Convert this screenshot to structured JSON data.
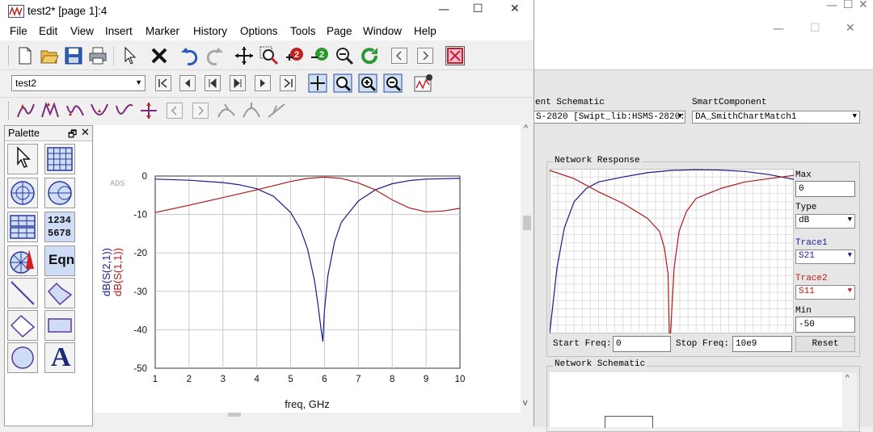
{
  "window": {
    "title": "test2* [page 1]:4"
  },
  "menu": [
    "File",
    "Edit",
    "View",
    "Insert",
    "Marker",
    "History",
    "Options",
    "Tools",
    "Page",
    "Window",
    "Help"
  ],
  "toolbar": {
    "page_select": "test2"
  },
  "palette": {
    "title": "Palette",
    "number_icon_top": "1234",
    "number_icon_bottom": "5678",
    "eqn_label": "Eqn",
    "text_label": "A"
  },
  "plot": {
    "watermark": "ADS",
    "xlabel": "freq, GHz",
    "ylabel_blue": "dB(S(2,1))",
    "ylabel_red": "dB(S(1,1))"
  },
  "chart_data": [
    {
      "type": "line",
      "title": "",
      "xlabel": "freq, GHz",
      "ylabel": "dB(S(2,1)) / dB(S(1,1))",
      "xlim": [
        1,
        10
      ],
      "ylim": [
        -50,
        0
      ],
      "xticks": [
        1,
        2,
        3,
        4,
        5,
        6,
        7,
        8,
        9,
        10
      ],
      "yticks": [
        0,
        -10,
        -20,
        -30,
        -40,
        -50
      ],
      "grid": true,
      "series": [
        {
          "name": "dB(S(2,1))",
          "color": "#1a1a8c",
          "x": [
            1,
            2,
            3,
            3.5,
            4,
            4.5,
            5,
            5.3,
            5.5,
            5.7,
            5.8,
            5.9,
            5.95,
            6.0,
            6.1,
            6.3,
            6.5,
            7,
            7.5,
            8,
            8.5,
            9,
            10
          ],
          "y": [
            -0.8,
            -1.1,
            -1.7,
            -2.3,
            -3.3,
            -5.3,
            -9.5,
            -14,
            -19,
            -27,
            -33,
            -40,
            -43,
            -35,
            -26,
            -17,
            -12,
            -6.5,
            -3.6,
            -2.0,
            -1.2,
            -0.8,
            -0.6
          ]
        },
        {
          "name": "dB(S(1,1))",
          "color": "#b01818",
          "x": [
            1,
            2,
            3,
            4,
            4.5,
            5,
            5.5,
            6,
            6.5,
            7,
            7.5,
            8,
            8.5,
            9,
            9.5,
            10
          ],
          "y": [
            -9.5,
            -7.6,
            -5.6,
            -3.6,
            -2.5,
            -1.4,
            -0.6,
            -0.3,
            -0.6,
            -1.8,
            -3.6,
            -6.2,
            -8.3,
            -9.3,
            -9.1,
            -8.4
          ]
        }
      ]
    },
    {
      "type": "line",
      "title": "Network Response",
      "ylim": [
        -50,
        0
      ],
      "grid": true,
      "series": [
        {
          "name": "S21",
          "color": "#1a1a8c",
          "x": [
            0,
            0.3,
            0.6,
            1,
            1.5,
            2,
            3,
            4,
            5,
            6,
            7,
            8,
            9,
            10
          ],
          "y": [
            -50,
            -30,
            -18,
            -10,
            -6,
            -4,
            -2.5,
            -1.2,
            -0.5,
            -0.3,
            -0.4,
            -0.8,
            -1.8,
            -3.2
          ]
        },
        {
          "name": "S11",
          "color": "#b01818",
          "x": [
            0,
            1,
            2,
            3,
            4,
            4.5,
            4.7,
            4.85,
            4.9,
            4.95,
            5.1,
            5.3,
            5.6,
            6,
            7,
            8,
            9,
            10
          ],
          "y": [
            -0.5,
            -3,
            -7,
            -10.5,
            -15,
            -19,
            -24,
            -32,
            -50,
            -50,
            -30,
            -19,
            -13,
            -9,
            -6,
            -4,
            -3,
            -2
          ]
        }
      ]
    }
  ],
  "right_panel": {
    "schematic_label": "ent Schematic",
    "schematic_value": "S-2820 [Swipt_lib:HSMS-2820:",
    "smart_label": "SmartComponent",
    "smart_value": "DA_SmithChartMatch1",
    "network_response_title": "Network Response",
    "max_label": "Max",
    "max_value": "0",
    "type_label": "Type",
    "type_value": "dB",
    "trace1_label": "Trace1",
    "trace1_value": "S21",
    "trace2_label": "Trace2",
    "trace2_value": "S11",
    "min_label": "Min",
    "min_value": "-50",
    "start_freq_label": "Start Freq:",
    "start_freq_value": "0",
    "stop_freq_label": "Stop Freq:",
    "stop_freq_value": "10e9",
    "reset_label": "Reset",
    "network_schematic_title": "Network Schematic"
  },
  "colors": {
    "trace_blue": "#1a1a8c",
    "trace_red": "#b01818",
    "trace1_label": "#1a1aa0",
    "trace2_label": "#c01818"
  }
}
